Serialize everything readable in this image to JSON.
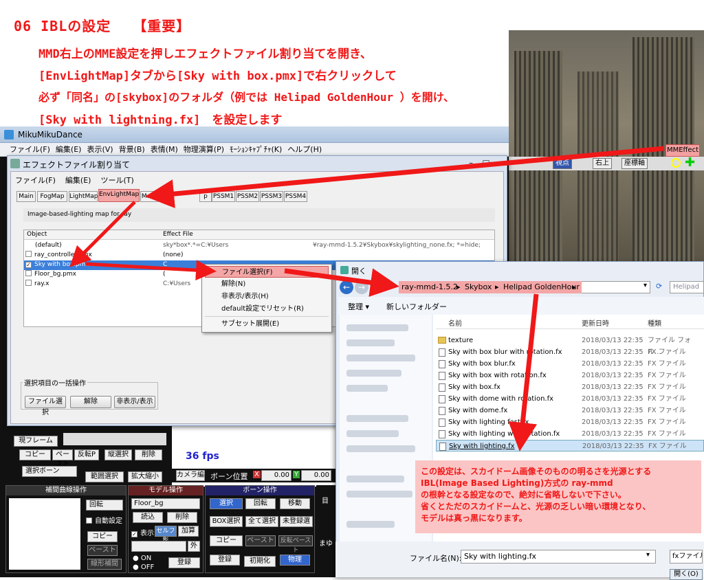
{
  "heading": {
    "line1": "06 IBLの設定　　【重要】",
    "line2": "MMD右上のMME設定を押しエフェクトファイル割り当てを開き、",
    "line3": "[EnvLightMap]タブから[Sky with box.pmx]で右クリックして",
    "line4": "必ず「同名」の[skybox]のフォルダ（例では Helipad GoldenHour ）を開け、",
    "line5": "[Sky with lightning.fx]　を設定します"
  },
  "mmd": {
    "title": "MikuMikuDance",
    "menu": [
      "ファイル(F)",
      "編集(E)",
      "表示(V)",
      "背景(B)",
      "表情(M)",
      "物理演算(P)",
      "ﾓｰｼｮﾝｷｬﾌﾟﾁｬ(K)",
      "ヘルプ(H)"
    ],
    "mme_button": "MMEffect",
    "toolbar": [
      "視点",
      "右上",
      "座標軸"
    ],
    "fps": "36 fps",
    "camera_tab": "カメラ編",
    "bone_pos_label": "ボーン位置",
    "bone_x": "0.00",
    "bone_y": "0.00",
    "axis_x": "X",
    "axis_y": "Y",
    "frame_label": "現フレーム",
    "copy_buttons": [
      "コピー",
      "ペースト",
      "反転P",
      "縦選択",
      "削除"
    ],
    "bone_select": "選択ボーン",
    "range_select": "範囲選択",
    "expand": "拡大縮小",
    "interp_title": "補間曲線操作",
    "interp_rotate": "回転",
    "interp_auto": "自動設定",
    "interp_copy": "コピー",
    "interp_paste": "ペースト",
    "interp_linear": "線形補間",
    "model_title": "モデル操作",
    "model_name": "Floor_bg",
    "model_load": "読込",
    "model_delete": "削除",
    "model_show": "表示",
    "model_self_shadow": "セルフ影",
    "model_add": "加算",
    "model_outer": "外",
    "model_on": "ON",
    "model_off": "OFF",
    "model_register": "登録",
    "bone_title": "ボーン操作",
    "bone_select_btn": "選択",
    "bone_rotate": "回転",
    "bone_move": "移動",
    "bone_box": "BOX選択",
    "bone_all": "全て選択",
    "bone_unregistered": "未登録選",
    "bone_copy": "コピー",
    "bone_paste": "ペースト",
    "bone_flip_paste": "反転ペースト",
    "bone_register": "登録",
    "bone_init": "初期化",
    "bone_physics": "物理",
    "side_label_1": "目",
    "side_label_2": "まゆ"
  },
  "effect": {
    "title": "エフェクトファイル割り当て",
    "menu": [
      "ファイル(F)",
      "編集(E)",
      "ツール(T)"
    ],
    "tabs": [
      "Main",
      "FogMap",
      "LightMap",
      "EnvLightMap",
      "Mate",
      "p",
      "PSSM1",
      "PSSM2",
      "PSSM3",
      "PSSM4"
    ],
    "description": "Image-based-lighting map for ray",
    "col_object": "Object",
    "col_effect": "Effect File",
    "rows": [
      {
        "name": "(default)",
        "checked": false,
        "effect": "sky*box*.*=C:¥Users",
        "effect2": "¥ray-mmd-1.5.2¥Skybox¥skylighting_none.fx; *=hide;"
      },
      {
        "name": "ray_controller.pmx",
        "checked": false,
        "effect": "(none)",
        "effect2": ""
      },
      {
        "name": "Sky with box.pmx",
        "checked": true,
        "effect": "C",
        "effect2": ""
      },
      {
        "name": "Floor_bg.pmx",
        "checked": false,
        "effect": "(",
        "effect2": ""
      },
      {
        "name": "ray.x",
        "checked": false,
        "effect": "C:¥Users",
        "effect2": ""
      }
    ],
    "batch_label": "選択項目の一括操作",
    "batch_buttons": [
      "ファイル選択",
      "解除",
      "非表示/表示"
    ]
  },
  "context_menu": {
    "items": [
      "ファイル選択(F)",
      "解除(N)",
      "非表示/表示(H)",
      "default設定でリセット(R)",
      "サブセット展開(E)"
    ]
  },
  "open_dialog": {
    "title": "開く",
    "breadcrumb": [
      "ray-mmd-1.5.2",
      "Skybox",
      "Helipad GoldenHour"
    ],
    "search_placeholder": "Helipad",
    "organize": "整理 ▾",
    "new_folder": "新しいフォルダー",
    "col_name": "名前",
    "col_date": "更新日時",
    "col_type": "種類",
    "files": [
      {
        "name": "texture",
        "date": "2018/03/13 22:35",
        "type": "ファイル フォル...",
        "folder": true
      },
      {
        "name": "Sky with box blur with rotation.fx",
        "date": "2018/03/13 22:35",
        "type": "FX ファイル",
        "folder": false
      },
      {
        "name": "Sky with box blur.fx",
        "date": "2018/03/13 22:35",
        "type": "FX ファイル",
        "folder": false
      },
      {
        "name": "Sky with box with rotation.fx",
        "date": "2018/03/13 22:35",
        "type": "FX ファイル",
        "folder": false
      },
      {
        "name": "Sky with box.fx",
        "date": "2018/03/13 22:35",
        "type": "FX ファイル",
        "folder": false
      },
      {
        "name": "Sky with dome with rotation.fx",
        "date": "2018/03/13 22:35",
        "type": "FX ファイル",
        "folder": false
      },
      {
        "name": "Sky with dome.fx",
        "date": "2018/03/13 22:35",
        "type": "FX ファイル",
        "folder": false
      },
      {
        "name": "Sky with lighting fast.fx",
        "date": "2018/03/13 22:35",
        "type": "FX ファイル",
        "folder": false
      },
      {
        "name": "Sky with lighting with rotation.fx",
        "date": "2018/03/13 22:35",
        "type": "FX ファイル",
        "folder": false
      },
      {
        "name": "Sky with lighting.fx",
        "date": "2018/03/13 22:35",
        "type": "FX ファイル",
        "folder": false
      }
    ],
    "filename_label": "ファイル名(N):",
    "filename_value": "Sky with lighting.fx",
    "filetype": "fxファイル",
    "open_button": "開く(O)"
  },
  "note": {
    "line1": "この設定は、スカイドーム画像そのものの明るさを光源とする",
    "line2": "IBL(Image Based Lighting)方式の ray-mmd",
    "line3": "の根幹となる設定なので、絶対に省略しないで下さい。",
    "line4": "省くとただのスカイドームと、光源の乏しい暗い環境となり、",
    "line5": "モデルは真っ黒になります。"
  },
  "colors": {
    "accent_red": "#f01818",
    "highlight_pink": "#f4a6a6",
    "selection_blue": "#3b7fd9"
  }
}
